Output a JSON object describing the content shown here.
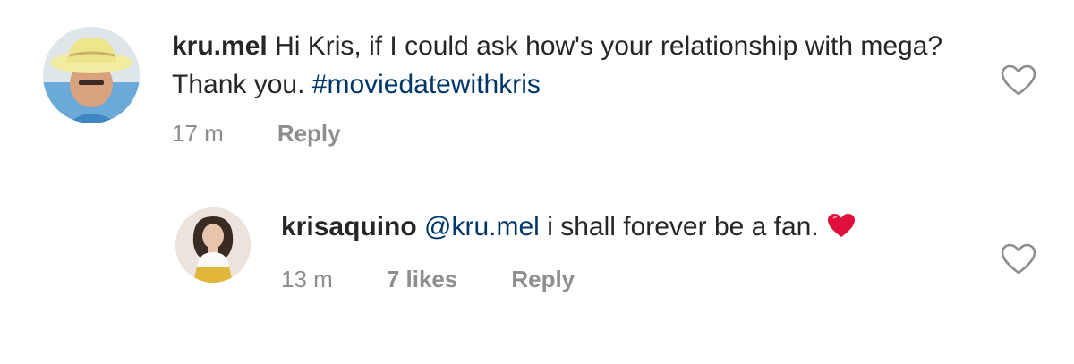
{
  "comments": [
    {
      "username": "kru.mel",
      "text": "Hi Kris, if I could ask how's your relationship with mega? Thank you.",
      "hashtag": "#moviedatewithkris",
      "time": "17 m",
      "reply_label": "Reply",
      "avatar_icon": "user-avatar-cowboy-hat",
      "like_icon": "heart-outline-icon"
    },
    {
      "username": "krisaquino",
      "mention": "@kru.mel",
      "text": "i shall forever be a fan.",
      "emoji": "red-heart-icon",
      "time": "13 m",
      "likes": "7 likes",
      "reply_label": "Reply",
      "avatar_icon": "user-avatar-photo",
      "like_icon": "heart-outline-icon"
    }
  ],
  "colors": {
    "text": "#262626",
    "muted": "#8e8e8e",
    "link": "#00376b",
    "heart_red": "#e0103a"
  }
}
